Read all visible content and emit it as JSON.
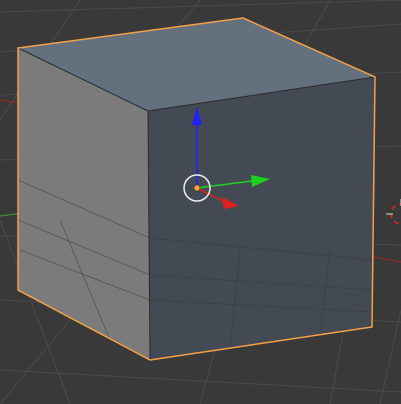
{
  "viewport": {
    "background": "#393939",
    "grid_color": "#484848",
    "x_axis_color": "#8a2c2c",
    "y_axis_color": "#3f8a2c"
  },
  "object": {
    "type": "cube",
    "selected": true,
    "outline_color": "#f5a14a",
    "top_face_color": "#65707e",
    "left_face_color": "#7b7b7b",
    "right_face_color": "#434a54"
  },
  "origin": {
    "color": "#f5a14a",
    "ring_color": "#f0f0f0"
  },
  "gizmo": {
    "x_color": "#e02020",
    "y_color": "#20d020",
    "z_color": "#2020ff"
  },
  "icons": {
    "gizmo": "transform-manipulator-icon",
    "origin": "object-origin-icon",
    "cursor": "3d-cursor-icon"
  }
}
